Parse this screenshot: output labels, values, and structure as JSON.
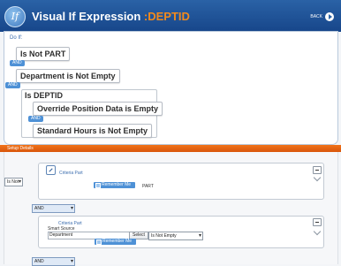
{
  "header": {
    "logo_text": "If",
    "title": "Visual If Expression ",
    "title_accent": ":DEPTID",
    "back_label": "BACK"
  },
  "expression": {
    "do_if_label": "Do If:",
    "c1": "Is Not PART",
    "and1": "AND",
    "c2": "Department is Not Empty",
    "and2": "AND",
    "group_title": "Is DEPTID",
    "c3": "Override Position Data is Empty",
    "and3": "AND",
    "c4": "Standard Hours is Not Empty"
  },
  "setup": {
    "bar_label": "Setup Details",
    "is_not_select": "Is Not",
    "crit1": {
      "title": "Criteria Part",
      "remember": "Remember Me",
      "value": "PART"
    },
    "logic1": "AND",
    "crit2": {
      "title": "Criteria Part",
      "source_label": "Smart Source",
      "source_value": "Department",
      "select_btn": "Select",
      "operator": "Is Not Empty",
      "remember": "Remember Me"
    },
    "logic2": "AND"
  },
  "colors": {
    "header_blue": "#1f56a0",
    "accent_orange": "#f28a1c",
    "setup_bar": "#e8640f",
    "pill_blue": "#4e91d6"
  }
}
